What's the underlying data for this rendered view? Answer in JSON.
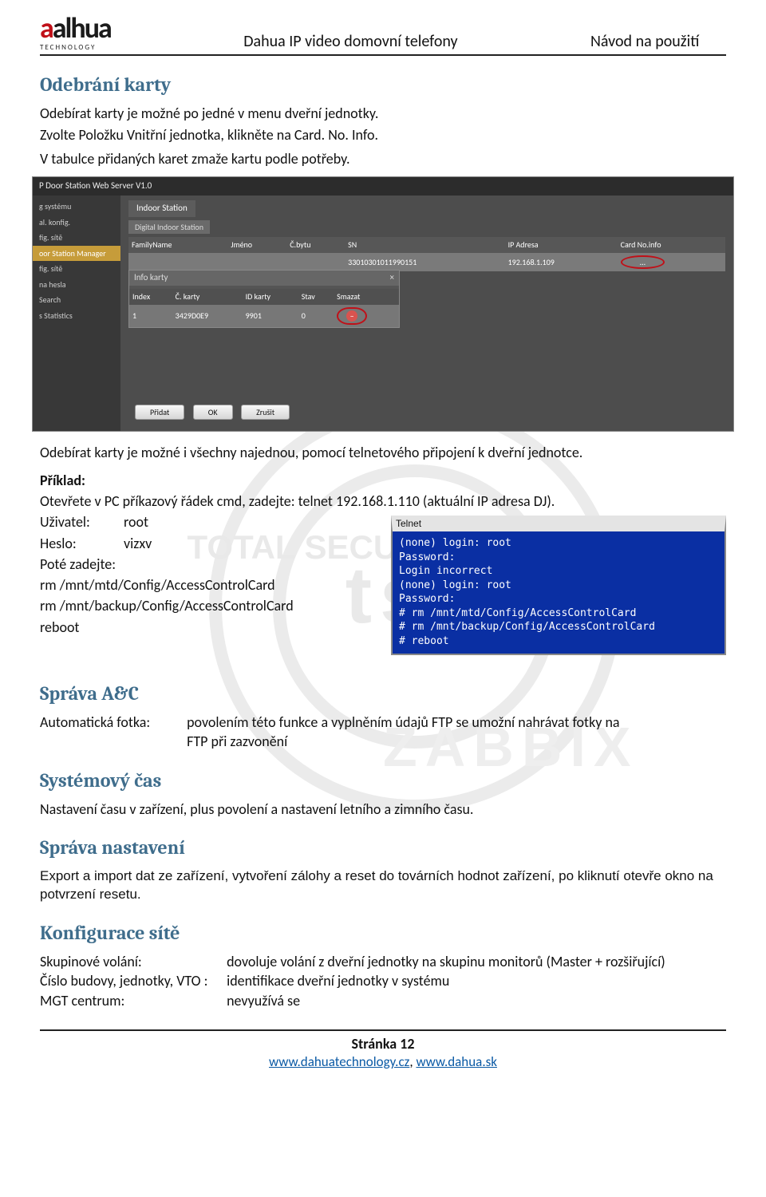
{
  "header": {
    "logo_main": "alhua",
    "logo_sub": "TECHNOLOGY",
    "center": "Dahua IP video domovní telefony",
    "right": "Návod na použití"
  },
  "s1": {
    "title": "Odebrání karty",
    "p1": "Odebírat karty je možné po jedné v menu dveřní jednotky.",
    "p2": "Zvolte Položku Vnitřní jednotka, klikněte na Card. No. Info.",
    "p3": "V tabulce přidaných karet zmaže kartu podle potřeby."
  },
  "shot1": {
    "title": "P Door Station  Web Server V1.0",
    "side": [
      "g systému",
      "al. konfig.",
      "fig. sítě",
      "oor Station Manager",
      "fig. sítě",
      "na hesla",
      "Search",
      "s Statistics"
    ],
    "side_active_index": 3,
    "tab": "Indoor Station",
    "subtab": "Digital Indoor Station",
    "cols": [
      "FamilyName",
      "Jméno",
      "Č.bytu",
      "SN",
      "IP Adresa",
      "Card No.info"
    ],
    "row": {
      "family": "",
      "jmeno": "",
      "cbytu": "",
      "sn": "33010301011990151",
      "ip": "192.168.1.109",
      "card": "..."
    },
    "dialog_title": "Info karty",
    "dcols": [
      "Index",
      "Č. karty",
      "ID karty",
      "Stav",
      "Smazat"
    ],
    "drow": {
      "index": "1",
      "ckarty": "3429D0E9",
      "idkarty": "9901",
      "stav": "0"
    },
    "btn_pridat": "Přidat",
    "btn_ok": "OK",
    "btn_zrusit": "Zrušit"
  },
  "s2": {
    "p1": "Odebírat karty je možné i všechny najednou, pomocí telnetového připojení k dveřní jednotce.",
    "priklad": "Příklad:",
    "otevrete": "Otevřete v PC příkazový řádek cmd, zadejte: telnet 192.168.1.110 (aktuální IP adresa DJ).",
    "uzivatel_k": "Uživatel:",
    "uzivatel_v": "root",
    "heslo_k": "Heslo:",
    "heslo_v": "vizxv",
    "pote": "Poté zadejte:",
    "cmd1": "rm /mnt/mtd/Config/AccessControlCard",
    "cmd2": "rm /mnt/backup/Config/AccessControlCard",
    "cmd3": "reboot"
  },
  "telnet": {
    "title": "Telnet",
    "lines": [
      "(none) login: root",
      "Password:",
      "Login incorrect",
      "(none) login: root",
      "Password:",
      "# rm /mnt/mtd/Config/AccessControlCard",
      "# rm /mnt/backup/Config/AccessControlCard",
      "# reboot"
    ]
  },
  "ac": {
    "title": "Správa A&C",
    "k": "Automatická fotka:",
    "v1": "povolením této funkce a vyplněním údajů FTP se umožní nahrávat fotky na",
    "v2": "FTP při zazvonění"
  },
  "cas": {
    "title": "Systémový čas",
    "p": "Nastavení času v zařízení, plus povolení a nastavení letního a zimního času."
  },
  "nast": {
    "title": "Správa nastavení",
    "p": "Export a import dat ze zařízení, vytvoření zálohy a reset do továrních hodnot zařízení, po kliknutí otevře okno na potvrzení resetu."
  },
  "net": {
    "title": "Konfigurace sítě",
    "r1k": "Skupinové volání:",
    "r1v": "dovoluje volání z dveřní jednotky na skupinu monitorů (Master + rozšiřující)",
    "r2k": "Číslo budovy, jednotky, VTO :",
    "r2v": "identifikace dveřní jednotky v systému",
    "r3k": "MGT centrum:",
    "r3v": "nevyužívá se"
  },
  "footer": {
    "page": "Stránka 12",
    "link1": "www.dahuatechnology.cz",
    "sep": ", ",
    "link2": "www.dahua.sk"
  }
}
